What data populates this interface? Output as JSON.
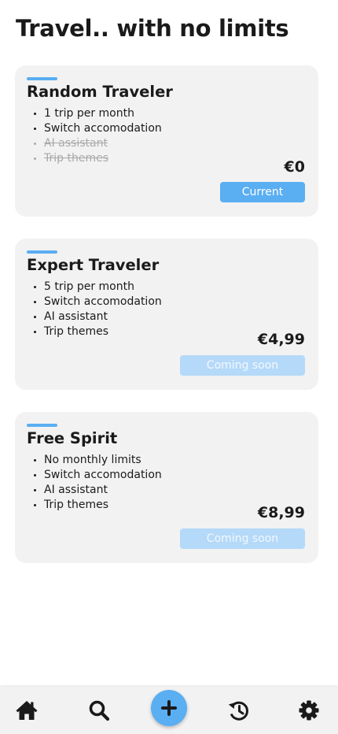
{
  "header": {
    "title": "Travel.. with no limits"
  },
  "plans": [
    {
      "name": "Random Traveler",
      "features": [
        {
          "label": "1 trip per month",
          "enabled": true
        },
        {
          "label": "Switch accomodation",
          "enabled": true
        },
        {
          "label": "AI assistant",
          "enabled": false
        },
        {
          "label": "Trip themes",
          "enabled": false
        }
      ],
      "price": "€0",
      "button_label": "Current",
      "button_state": "current"
    },
    {
      "name": "Expert Traveler",
      "features": [
        {
          "label": "5 trip per month",
          "enabled": true
        },
        {
          "label": "Switch accomodation",
          "enabled": true
        },
        {
          "label": "AI assistant",
          "enabled": true
        },
        {
          "label": "Trip themes",
          "enabled": true
        }
      ],
      "price": "€4,99",
      "button_label": "Coming soon",
      "button_state": "disabled"
    },
    {
      "name": "Free Spirit",
      "features": [
        {
          "label": "No monthly limits",
          "enabled": true
        },
        {
          "label": "Switch accomodation",
          "enabled": true
        },
        {
          "label": "AI assistant",
          "enabled": true
        },
        {
          "label": "Trip themes",
          "enabled": true
        }
      ],
      "price": "€8,99",
      "button_label": "Coming soon",
      "button_state": "disabled"
    }
  ],
  "bottom_nav": {
    "items": [
      {
        "icon": "home-icon"
      },
      {
        "icon": "search-icon"
      },
      {
        "icon": "plus-icon"
      },
      {
        "icon": "history-icon"
      },
      {
        "icon": "gear-icon"
      }
    ]
  },
  "colors": {
    "accent": "#5aaef2",
    "accent_disabled": "#b5d9f8",
    "card_background": "#f2f2f2",
    "text": "#1a1a1a",
    "disabled_text": "#a9a9a9"
  }
}
